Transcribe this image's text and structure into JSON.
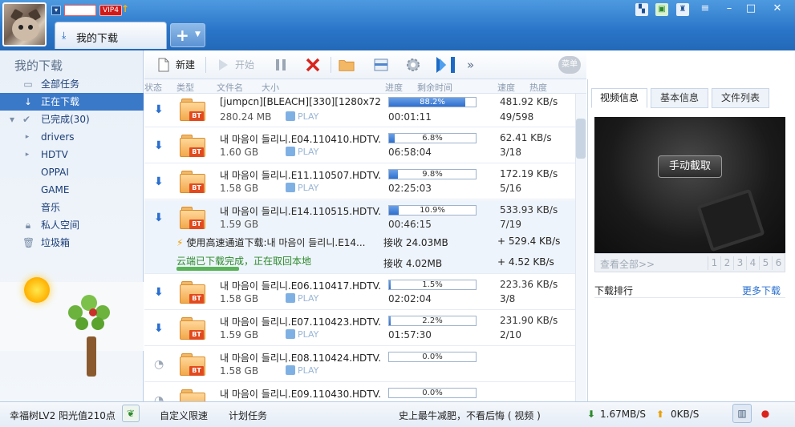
{
  "window": {
    "vip_badge": "VIP4",
    "tab_label": "我的下载"
  },
  "sidebar": {
    "title": "我的下载",
    "items": [
      {
        "label": "全部任务",
        "icon": "document-icon"
      },
      {
        "label": "正在下载",
        "icon": "download-arrow-icon",
        "selected": true
      },
      {
        "label": "已完成(30)",
        "icon": "check-icon"
      },
      {
        "label": "drivers",
        "icon": "folder-icon"
      },
      {
        "label": "HDTV",
        "icon": "folder-icon"
      },
      {
        "label": "OPPAI",
        "icon": "folder-icon"
      },
      {
        "label": "GAME",
        "icon": "folder-icon"
      },
      {
        "label": "音乐",
        "icon": "folder-icon"
      },
      {
        "label": "私人空间",
        "icon": "lock-icon"
      },
      {
        "label": "垃圾箱",
        "icon": "trash-icon"
      }
    ]
  },
  "toolbar": {
    "new_label": "新建",
    "start_label": "开始",
    "menu_label": "菜单"
  },
  "columns": {
    "status": "状态",
    "type": "类型",
    "filename": "文件名",
    "size": "大小",
    "progress": "进度",
    "remaining": "剩余时间",
    "speed": "速度",
    "heat": "热度"
  },
  "tasks": [
    {
      "name": "[jumpcn][BLEACH][330][1280x720]",
      "size": "280.24 MB",
      "progress": 88.2,
      "progress_text": "88.2%",
      "remaining": "00:01:11",
      "speed": "481.92 KB/s",
      "seeds": "49/598",
      "status": "downloading",
      "play": "PLAY"
    },
    {
      "name": "내 마음이 들리니.E04.110410.HDTV...",
      "size": "1.60 GB",
      "progress": 6.8,
      "progress_text": "6.8%",
      "remaining": "06:58:04",
      "speed": "62.41 KB/s",
      "seeds": "3/18",
      "status": "downloading",
      "play": "PLAY"
    },
    {
      "name": "내 마음이 들리니.E11.110507.HDTV...",
      "size": "1.58 GB",
      "progress": 9.8,
      "progress_text": "9.8%",
      "remaining": "02:25:03",
      "speed": "172.19 KB/s",
      "seeds": "5/16",
      "status": "downloading",
      "play": "PLAY"
    },
    {
      "name": "내 마음이 들리니.E14.110515.HDTV...",
      "size": "1.59 GB",
      "progress": 10.9,
      "progress_text": "10.9%",
      "remaining": "00:46:15",
      "speed": "533.93 KB/s",
      "seeds": "7/19",
      "status": "downloading",
      "play": "",
      "expanded": {
        "channel_label": "使用高速通道下载:내 마음이 들리니.E14...",
        "channel_recv": "接收 24.03MB",
        "channel_speed": "+ 529.4 KB/s",
        "cloud_label": "云端已下载完成，正在取回本地",
        "cloud_recv": "接收 4.02MB",
        "cloud_speed": "+ 4.52 KB/s"
      }
    },
    {
      "name": "내 마음이 들리니.E06.110417.HDTV...",
      "size": "1.58 GB",
      "progress": 1.5,
      "progress_text": "1.5%",
      "remaining": "02:02:04",
      "speed": "223.36 KB/s",
      "seeds": "3/8",
      "status": "downloading",
      "play": "PLAY"
    },
    {
      "name": "내 마음이 들리니.E07.110423.HDTV...",
      "size": "1.59 GB",
      "progress": 2.2,
      "progress_text": "2.2%",
      "remaining": "01:57:30",
      "speed": "231.90 KB/s",
      "seeds": "2/10",
      "status": "downloading",
      "play": "PLAY"
    },
    {
      "name": "내 마음이 들리니.E08.110424.HDTV...",
      "size": "1.58 GB",
      "progress": 0.0,
      "progress_text": "0.0%",
      "remaining": "",
      "speed": "",
      "seeds": "",
      "status": "waiting",
      "play": "PLAY"
    },
    {
      "name": "내 마음이 들리니.E09.110430.HDTV...",
      "size": "",
      "progress": 0.0,
      "progress_text": "0.0%",
      "remaining": "",
      "speed": "",
      "seeds": "",
      "status": "waiting",
      "play": ""
    }
  ],
  "right_panel": {
    "tabs": [
      "视频信息",
      "基本信息",
      "文件列表"
    ],
    "capture_button": "手动截取",
    "view_all": "查看全部>>",
    "pages": [
      "1",
      "2",
      "3",
      "4",
      "5",
      "6"
    ],
    "rank_title": "下载排行",
    "rank_more": "更多下载"
  },
  "statusbar": {
    "level": "幸福树LV2 阳光值210点",
    "speed_limit": "自定义限速",
    "schedule": "计划任务",
    "news": "史上最牛减肥，不看后悔 ( 视频 )",
    "down_speed": "1.67MB/S",
    "up_speed": "0KB/S"
  },
  "colors": {
    "accent": "#2a75c8",
    "selected": "#3a78c8",
    "progress": "#2e6fcf",
    "cloud_green": "#2c8a2c",
    "delete_red": "#d9241c"
  }
}
